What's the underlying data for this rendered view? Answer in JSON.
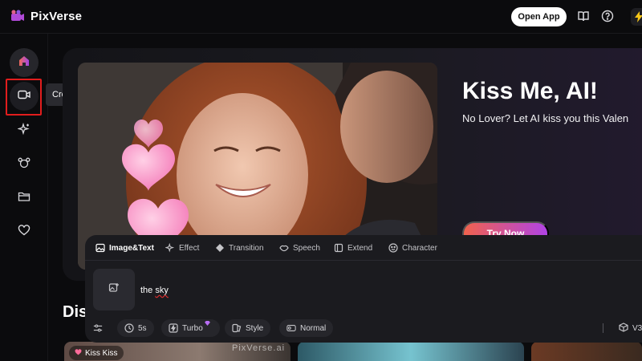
{
  "app": {
    "name": "PixVerse"
  },
  "header": {
    "open_app_label": "Open App",
    "icons": [
      "book-icon",
      "help-icon",
      "bolt-icon"
    ]
  },
  "sidebar": {
    "items": [
      {
        "name": "home",
        "icon": "home-icon"
      },
      {
        "name": "create",
        "icon": "video-camera-icon"
      },
      {
        "name": "effects",
        "icon": "sparkle-icon"
      },
      {
        "name": "characters",
        "icon": "bear-icon"
      },
      {
        "name": "assets",
        "icon": "folder-icon"
      },
      {
        "name": "favorites",
        "icon": "heart-icon"
      }
    ],
    "tooltip": "Create"
  },
  "hero": {
    "title": "Kiss Me, AI!",
    "subtitle": "No Lover? Let AI kiss you this Valen",
    "cta_label": "Try Now"
  },
  "prompt_panel": {
    "tabs": [
      {
        "label": "Image&Text",
        "icon": "image-icon",
        "active": true
      },
      {
        "label": "Effect",
        "icon": "sparkle-icon",
        "active": false
      },
      {
        "label": "Transition",
        "icon": "transition-icon",
        "active": false
      },
      {
        "label": "Speech",
        "icon": "lips-icon",
        "active": false
      },
      {
        "label": "Extend",
        "icon": "extend-icon",
        "active": false
      },
      {
        "label": "Character",
        "icon": "face-icon",
        "active": false
      }
    ],
    "prompt_text_a": "the ",
    "prompt_text_b": "sky",
    "options": {
      "duration": "5s",
      "mode": "Turbo",
      "style": "Style",
      "quality": "Normal"
    },
    "model": "V3"
  },
  "section": {
    "heading": "Dis"
  },
  "thumbnails": {
    "chip_label": "Kiss Kiss",
    "watermark": "PixVerse.ai"
  },
  "colors": {
    "accent": "#e11d1d",
    "cta_start": "#f0624d",
    "cta_end": "#b043e5",
    "panel": "#1b1b1f"
  }
}
